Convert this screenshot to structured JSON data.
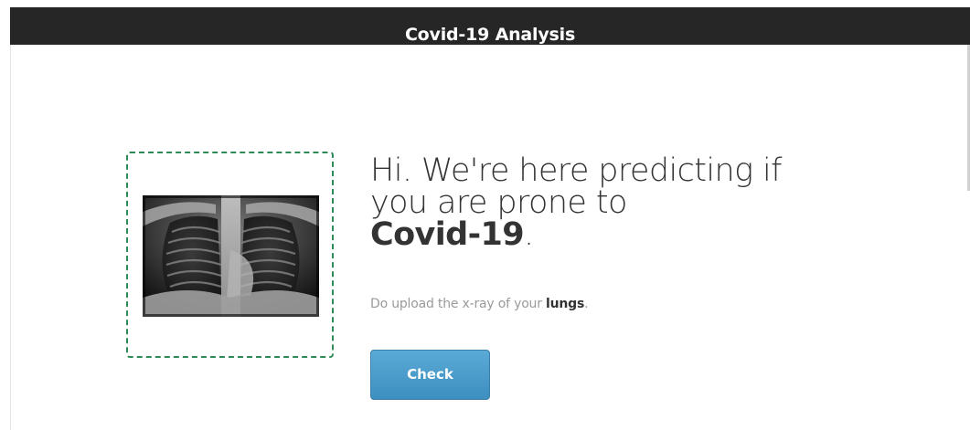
{
  "header": {
    "title": "Covid-19 Analysis"
  },
  "upload": {
    "image_subject": "chest x-ray"
  },
  "hero": {
    "line1": "Hi. We're here predicting if",
    "line2": "you are prone to",
    "line3_strong": "Covid-19",
    "line3_suffix": "."
  },
  "instruction": {
    "prefix": "Do upload the x-ray of your ",
    "strong": "lungs",
    "suffix": "."
  },
  "actions": {
    "check_label": "Check"
  },
  "colors": {
    "header_bg": "#262626",
    "dashed_border": "#2e8b57",
    "button": "#4a9ccb",
    "headline_text": "#333333",
    "muted_text": "#9a9a9a"
  }
}
